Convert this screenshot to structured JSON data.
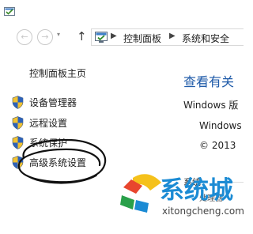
{
  "navigation": {
    "back_icon": "back-arrow-icon",
    "forward_icon": "forward-arrow-icon",
    "up_icon": "up-arrow-icon",
    "breadcrumb": [
      "控制面板",
      "系统和安全"
    ]
  },
  "left_pane": {
    "home_link": "控制面板主页",
    "tasks": [
      {
        "label": "设备管理器",
        "icon": "shield-icon"
      },
      {
        "label": "远程设置",
        "icon": "shield-icon"
      },
      {
        "label": "系统保护",
        "icon": "shield-icon"
      },
      {
        "label": "高级系统设置",
        "icon": "shield-icon"
      }
    ]
  },
  "right_pane": {
    "heading": "查看有关",
    "edition_line": "Windows 版",
    "edition_name": "Windows",
    "copyright": "© 2013",
    "system_section": "系统",
    "fragment": "处理器"
  },
  "watermark": {
    "brand": "系统城",
    "url": "xitongcheng.com"
  },
  "colors": {
    "heading_blue": "#1e5aa8",
    "watermark_blue": "#1b8bd4"
  }
}
